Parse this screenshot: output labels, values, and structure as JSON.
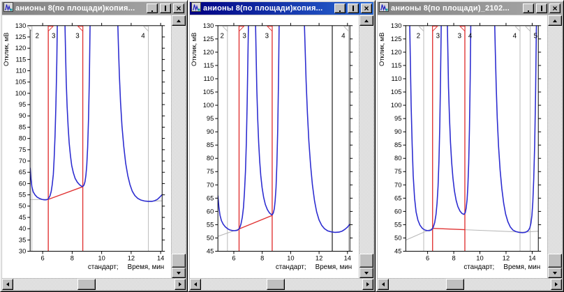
{
  "desktop": {
    "background": "#c0c0c0"
  },
  "icons": {
    "window_icon": "chromatogram-icon",
    "titlebar": [
      "minimize-icon",
      "maximize-icon",
      "close-icon"
    ],
    "scroll": [
      "scroll-up-icon",
      "scroll-down-icon",
      "scroll-left-icon",
      "scroll-right-icon"
    ]
  },
  "colors": {
    "curve": "#2b2bd0",
    "red": "#e03333",
    "grey": "#b9b9b9",
    "black": "#3c3c3c",
    "baseline_grey": "#c0c0c0",
    "plot_border": "#000000",
    "title_active_from": "#000082",
    "title_active_to": "#2a6ad4",
    "title_inactive_from": "#828282",
    "title_inactive_to": "#a8a8a8"
  },
  "windows": [
    {
      "title": "анионы 8(по площади)копия...",
      "active": false,
      "axes": {
        "y_label": "Отклик, мВ",
        "sample_label": "стандарт;",
        "units_label": "Время, мин",
        "y_min": 30,
        "y_max": 130,
        "y_step": 5,
        "x_min": 5.15,
        "x_max": 14.1,
        "x_ticks": [
          6,
          8,
          10,
          12,
          14
        ]
      },
      "markers": [
        {
          "t": 5.27,
          "kind": "grey",
          "label": "2",
          "side": "right",
          "flag": "left"
        },
        {
          "t": 6.38,
          "kind": "red",
          "label": "3",
          "side": "right",
          "flag": "right"
        },
        {
          "t": 8.72,
          "kind": "red",
          "label": "3",
          "side": "left",
          "flag": "left"
        },
        {
          "t": 13.17,
          "kind": "grey",
          "label": "4",
          "side": "left",
          "flag": "left"
        }
      ],
      "baselines": [
        {
          "kind": "grey",
          "points": [
            [
              5.15,
              52.9
            ],
            [
              6.38,
              53.0
            ]
          ]
        },
        {
          "kind": "red",
          "points": [
            [
              6.38,
              53.0
            ],
            [
              8.72,
              58.6
            ]
          ]
        },
        {
          "kind": "grey",
          "points": [
            [
              12.93,
              52.1
            ],
            [
              14.1,
              52.35
            ]
          ]
        }
      ],
      "curve": [
        [
          5.15,
          67
        ],
        [
          5.2,
          62
        ],
        [
          5.27,
          58.5
        ],
        [
          5.36,
          56.3
        ],
        [
          5.48,
          55.0
        ],
        [
          5.62,
          54.0
        ],
        [
          5.78,
          53.4
        ],
        [
          5.95,
          53.0
        ],
        [
          6.1,
          52.8
        ],
        [
          6.25,
          52.8
        ],
        [
          6.38,
          53.2
        ],
        [
          6.5,
          54.6
        ],
        [
          6.58,
          56.5
        ],
        [
          6.65,
          59.5
        ],
        [
          6.72,
          64
        ],
        [
          6.78,
          71
        ],
        [
          6.84,
          81
        ],
        [
          6.9,
          95
        ],
        [
          6.96,
          114
        ],
        [
          7.0,
          134
        ],
        [
          7.5,
          134
        ],
        [
          7.55,
          118
        ],
        [
          7.6,
          105
        ],
        [
          7.66,
          94
        ],
        [
          7.73,
          85
        ],
        [
          7.8,
          78
        ],
        [
          7.88,
          72.5
        ],
        [
          7.97,
          68
        ],
        [
          8.08,
          64.8
        ],
        [
          8.2,
          62.3
        ],
        [
          8.35,
          60.6
        ],
        [
          8.5,
          59.5
        ],
        [
          8.62,
          58.9
        ],
        [
          8.72,
          58.7
        ],
        [
          8.8,
          59.3
        ],
        [
          8.87,
          60.8
        ],
        [
          8.93,
          63.5
        ],
        [
          8.99,
          68
        ],
        [
          9.05,
          76
        ],
        [
          9.11,
          89
        ],
        [
          9.17,
          108
        ],
        [
          9.22,
          134
        ],
        [
          11.08,
          134
        ],
        [
          11.14,
          120
        ],
        [
          11.2,
          108
        ],
        [
          11.28,
          96
        ],
        [
          11.38,
          85.5
        ],
        [
          11.5,
          76.5
        ],
        [
          11.63,
          69
        ],
        [
          11.77,
          63.5
        ],
        [
          11.92,
          59.5
        ],
        [
          12.08,
          56.6
        ],
        [
          12.25,
          54.7
        ],
        [
          12.45,
          53.4
        ],
        [
          12.65,
          52.7
        ],
        [
          12.9,
          52.3
        ],
        [
          13.15,
          52.1
        ],
        [
          13.4,
          52.1
        ],
        [
          13.6,
          52.4
        ],
        [
          13.78,
          53.0
        ],
        [
          13.93,
          53.9
        ],
        [
          14.1,
          55.1
        ]
      ],
      "scroll": {
        "h_thumb": 0.45,
        "v_thumb": 1.0
      }
    },
    {
      "title": "анионы 8(по площади)копия...",
      "active": true,
      "axes": {
        "y_label": "Отклик, мВ",
        "sample_label": "стандарт;",
        "units_label": "Время, мин",
        "y_min": 45,
        "y_max": 130,
        "y_step": 5,
        "x_min": 4.88,
        "x_max": 14.17,
        "x_ticks": [
          6,
          8,
          10,
          12,
          14
        ]
      },
      "markers": [
        {
          "t": 5.55,
          "kind": "grey",
          "label": "2",
          "side": "left",
          "flag": "left"
        },
        {
          "t": 6.37,
          "kind": "red",
          "label": "3",
          "side": "right",
          "flag": "right"
        },
        {
          "t": 8.7,
          "kind": "red",
          "label": "3",
          "side": "left",
          "flag": "left"
        },
        {
          "t": 12.93,
          "kind": "black",
          "label": "",
          "side": "left",
          "flag": "none"
        },
        {
          "t": 14.08,
          "kind": "grey",
          "label": "4",
          "side": "left",
          "flag": "left"
        }
      ],
      "baselines": [
        {
          "kind": "grey",
          "points": [
            [
              4.88,
              50.6
            ],
            [
              6.37,
              53.4
            ]
          ]
        },
        {
          "kind": "red",
          "points": [
            [
              6.37,
              53.4
            ],
            [
              8.7,
              58.5
            ]
          ]
        }
      ],
      "curve": [
        [
          4.88,
          66
        ],
        [
          4.95,
          61.5
        ],
        [
          5.03,
          58.5
        ],
        [
          5.13,
          56.5
        ],
        [
          5.25,
          55.2
        ],
        [
          5.4,
          54.2
        ],
        [
          5.56,
          53.5
        ],
        [
          5.73,
          53.0
        ],
        [
          5.9,
          52.8
        ],
        [
          6.08,
          52.75
        ],
        [
          6.25,
          52.9
        ],
        [
          6.4,
          53.6
        ],
        [
          6.5,
          55.2
        ],
        [
          6.6,
          57.8
        ],
        [
          6.68,
          61.5
        ],
        [
          6.75,
          67
        ],
        [
          6.82,
          75
        ],
        [
          6.88,
          86
        ],
        [
          6.94,
          101
        ],
        [
          7.0,
          120
        ],
        [
          7.04,
          134
        ],
        [
          7.52,
          134
        ],
        [
          7.57,
          119
        ],
        [
          7.62,
          106
        ],
        [
          7.68,
          95
        ],
        [
          7.75,
          86
        ],
        [
          7.82,
          79
        ],
        [
          7.9,
          73.5
        ],
        [
          7.99,
          69
        ],
        [
          8.1,
          65.3
        ],
        [
          8.22,
          62.6
        ],
        [
          8.36,
          60.7
        ],
        [
          8.5,
          59.5
        ],
        [
          8.62,
          58.9
        ],
        [
          8.7,
          58.7
        ],
        [
          8.78,
          59.4
        ],
        [
          8.85,
          61
        ],
        [
          8.91,
          64
        ],
        [
          8.97,
          69
        ],
        [
          9.03,
          77.5
        ],
        [
          9.09,
          91
        ],
        [
          9.15,
          111
        ],
        [
          9.2,
          134
        ],
        [
          10.95,
          134
        ],
        [
          11.02,
          121
        ],
        [
          11.09,
          109
        ],
        [
          11.18,
          97
        ],
        [
          11.28,
          86.5
        ],
        [
          11.4,
          77.5
        ],
        [
          11.53,
          70
        ],
        [
          11.68,
          64
        ],
        [
          11.83,
          59.8
        ],
        [
          12.0,
          56.8
        ],
        [
          12.18,
          54.8
        ],
        [
          12.38,
          53.5
        ],
        [
          12.6,
          52.7
        ],
        [
          12.86,
          52.3
        ],
        [
          13.13,
          52.1
        ],
        [
          13.4,
          52.2
        ],
        [
          13.63,
          52.6
        ],
        [
          13.83,
          53.3
        ],
        [
          14.0,
          54.1
        ],
        [
          14.17,
          55.2
        ]
      ],
      "scroll": {
        "h_thumb": 0.46,
        "v_thumb": 1.0
      }
    },
    {
      "title": "анионы 8(по площади)_2102...",
      "active": false,
      "axes": {
        "y_label": "Отклик, мВ",
        "sample_label": "стандарт;",
        "units_label": "Время, мин",
        "y_min": 45,
        "y_max": 130,
        "y_step": 5,
        "x_min": 4.33,
        "x_max": 14.47,
        "x_ticks": [
          6,
          8,
          10,
          12,
          14
        ]
      },
      "markers": [
        {
          "t": 5.7,
          "kind": "grey",
          "label": "2",
          "side": "left",
          "flag": "left"
        },
        {
          "t": 6.38,
          "kind": "red",
          "label": "3",
          "side": "right",
          "flag": "right"
        },
        {
          "t": 8.85,
          "kind": "red",
          "label": "3",
          "side": "left",
          "flag": "left",
          "label2": "4",
          "side2": "right"
        },
        {
          "t": 13.07,
          "kind": "grey",
          "label": "4",
          "side": "left",
          "flag": "left"
        },
        {
          "t": 13.85,
          "kind": "grey",
          "label": "5",
          "side": "right",
          "flag": "left"
        }
      ],
      "baselines": [
        {
          "kind": "grey",
          "points": [
            [
              4.33,
              49.2
            ],
            [
              6.38,
              53.6
            ]
          ]
        },
        {
          "kind": "red",
          "points": [
            [
              6.38,
              53.6
            ],
            [
              8.85,
              53.15
            ]
          ]
        },
        {
          "kind": "grey",
          "points": [
            [
              8.85,
              53.1
            ],
            [
              13.3,
              52.2
            ],
            [
              14.47,
              52.55
            ]
          ]
        }
      ],
      "curve": [
        [
          4.62,
          134
        ],
        [
          4.68,
          116
        ],
        [
          4.74,
          100
        ],
        [
          4.82,
          85
        ],
        [
          4.9,
          73.5
        ],
        [
          5.0,
          65
        ],
        [
          5.12,
          59.8
        ],
        [
          5.26,
          56.7
        ],
        [
          5.42,
          54.8
        ],
        [
          5.6,
          53.6
        ],
        [
          5.78,
          53.0
        ],
        [
          5.95,
          52.8
        ],
        [
          6.12,
          52.75
        ],
        [
          6.28,
          53.0
        ],
        [
          6.42,
          53.9
        ],
        [
          6.54,
          55.8
        ],
        [
          6.64,
          58.8
        ],
        [
          6.72,
          63
        ],
        [
          6.8,
          69.5
        ],
        [
          6.87,
          79
        ],
        [
          6.93,
          92
        ],
        [
          6.99,
          110
        ],
        [
          7.05,
          134
        ],
        [
          7.5,
          134
        ],
        [
          7.55,
          120
        ],
        [
          7.6,
          107
        ],
        [
          7.67,
          95.5
        ],
        [
          7.75,
          86
        ],
        [
          7.84,
          78.5
        ],
        [
          7.94,
          72.5
        ],
        [
          8.05,
          67.8
        ],
        [
          8.18,
          64.2
        ],
        [
          8.32,
          61.8
        ],
        [
          8.48,
          60.1
        ],
        [
          8.64,
          59.2
        ],
        [
          8.78,
          58.9
        ],
        [
          8.88,
          59.5
        ],
        [
          8.95,
          61.2
        ],
        [
          9.02,
          64.5
        ],
        [
          9.08,
          69.5
        ],
        [
          9.14,
          78
        ],
        [
          9.2,
          91
        ],
        [
          9.26,
          110
        ],
        [
          9.31,
          134
        ],
        [
          11.12,
          134
        ],
        [
          11.18,
          120
        ],
        [
          11.25,
          107
        ],
        [
          11.33,
          95
        ],
        [
          11.43,
          84.5
        ],
        [
          11.55,
          75.5
        ],
        [
          11.68,
          68.5
        ],
        [
          11.82,
          63
        ],
        [
          11.97,
          59
        ],
        [
          12.14,
          56.1
        ],
        [
          12.32,
          54.2
        ],
        [
          12.52,
          53.0
        ],
        [
          12.75,
          52.4
        ],
        [
          13.0,
          52.1
        ],
        [
          13.25,
          52.0
        ],
        [
          13.45,
          52.1
        ],
        [
          13.6,
          52.4
        ],
        [
          13.72,
          52.9
        ],
        [
          13.82,
          53.8
        ],
        [
          13.9,
          55.5
        ],
        [
          13.98,
          58.5
        ],
        [
          14.05,
          63.5
        ],
        [
          14.12,
          72
        ],
        [
          14.19,
          85
        ],
        [
          14.26,
          104
        ],
        [
          14.32,
          128
        ],
        [
          14.34,
          134
        ]
      ],
      "scroll": {
        "h_thumb": 0.4,
        "v_thumb": 1.0
      }
    }
  ]
}
